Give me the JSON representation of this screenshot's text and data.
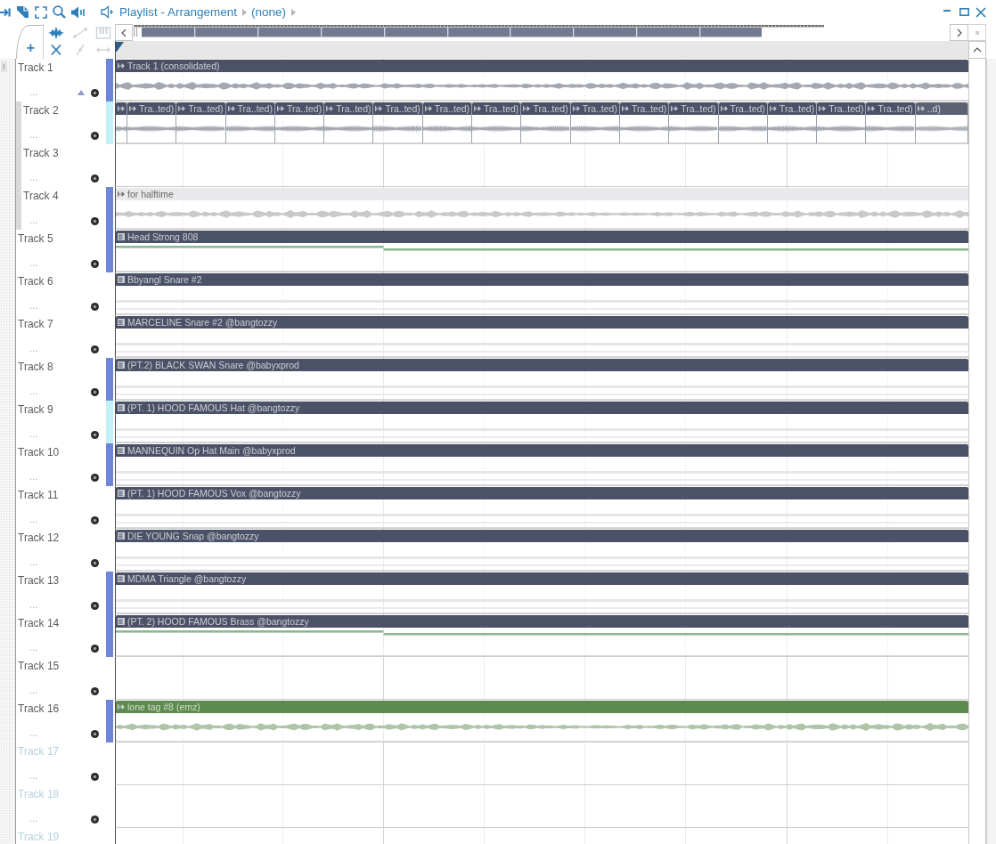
{
  "window": {
    "title": "Playlist - Arrangement",
    "pattern": "(none)"
  },
  "side_panel": {
    "label": "!"
  },
  "toolbar": {
    "add_label": "+",
    "tools": [
      {
        "disabled": false
      },
      {
        "disabled": true
      },
      {
        "disabled": true
      },
      {
        "disabled": false
      },
      {
        "disabled": true
      },
      {
        "disabled": true
      }
    ]
  },
  "tracks": [
    {
      "name": "Track 1",
      "more": "...",
      "color": "#6f86d8",
      "disabled": false,
      "expanded": true,
      "clips": [
        {
          "kind": "audio",
          "label": "Track 1 (consolidated)",
          "color": "#4b5167"
        }
      ],
      "children": [
        {
          "name": "Track 2",
          "more": "...",
          "color": "#c4f1f5",
          "disabled": false,
          "clips": [
            {
              "kind": "audio",
              "color": "#4b5167"
            },
            {
              "kind": "audio",
              "label": "Tra..ted)",
              "color": "#4b5167"
            },
            {
              "kind": "audio",
              "label": "Tra..ted)",
              "color": "#4b5167"
            },
            {
              "kind": "audio",
              "label": "Tra..ted)",
              "color": "#4b5167"
            },
            {
              "kind": "audio",
              "label": "Tra..ted)",
              "color": "#4b5167"
            },
            {
              "kind": "audio",
              "label": "Tra..ted)",
              "color": "#4b5167"
            },
            {
              "kind": "audio",
              "label": "Tra..ted)",
              "color": "#4b5167"
            },
            {
              "kind": "audio",
              "label": "Tra..ted)",
              "color": "#4b5167"
            },
            {
              "kind": "audio",
              "label": "Tra..ted)",
              "color": "#4b5167"
            },
            {
              "kind": "audio",
              "label": "Tra..ted)",
              "color": "#4b5167"
            },
            {
              "kind": "audio",
              "label": "Tra..ted)",
              "color": "#4b5167"
            },
            {
              "kind": "audio",
              "label": "Tra..ted)",
              "color": "#4b5167"
            },
            {
              "kind": "audio",
              "label": "Tra..ted)",
              "color": "#4b5167"
            },
            {
              "kind": "audio",
              "label": "Tra..ted)",
              "color": "#4b5167"
            },
            {
              "kind": "audio",
              "label": "Tra..ted)",
              "color": "#4b5167"
            },
            {
              "kind": "audio",
              "label": "Tra..ted)",
              "color": "#4b5167"
            },
            {
              "kind": "audio",
              "label": "Tra..ted)",
              "color": "#4b5167"
            },
            {
              "kind": "audio",
              "label": "..d)",
              "color": "#5c6273"
            }
          ]
        },
        {
          "name": "Track 3",
          "more": "...",
          "disabled": false
        },
        {
          "name": "Track 4",
          "more": "...",
          "color": "#6f86d8",
          "disabled": false,
          "clips": [
            {
              "kind": "audio",
              "label": "for halftime",
              "color": "#e9e9eb"
            }
          ]
        }
      ]
    },
    {
      "name": "Track 5",
      "more": "...",
      "color": "#6f86d8",
      "disabled": false,
      "clips": [
        {
          "kind": "pattern",
          "label": "Head Strong 808",
          "color": "#4b5167",
          "sustained": true
        }
      ]
    },
    {
      "name": "Track 6",
      "more": "...",
      "disabled": false,
      "clips": [
        {
          "kind": "pattern",
          "label": "Bbyangl Snare #2",
          "color": "#4b5167",
          "sustained": false
        }
      ]
    },
    {
      "name": "Track 7",
      "more": "...",
      "disabled": false,
      "clips": [
        {
          "kind": "pattern",
          "label": "MARCELINE Snare #2 @bangtozzy",
          "color": "#4b5167",
          "sustained": false
        }
      ]
    },
    {
      "name": "Track 8",
      "more": "...",
      "color": "#6f86d8",
      "disabled": false,
      "clips": [
        {
          "kind": "pattern",
          "label": "(PT.2) BLACK SWAN Snare @babyxprod",
          "color": "#4b5167",
          "sustained": false
        }
      ]
    },
    {
      "name": "Track 9",
      "more": "...",
      "color": "#c4f1f5",
      "disabled": false,
      "clips": [
        {
          "kind": "pattern",
          "label": "(PT. 1) HOOD FAMOUS Hat @bangtozzy",
          "color": "#4b5167",
          "sustained": false
        }
      ]
    },
    {
      "name": "Track 10",
      "more": "...",
      "color": "#6f86d8",
      "disabled": false,
      "clips": [
        {
          "kind": "pattern",
          "label": "MANNEQUIN Op Hat Main @babyxprod",
          "color": "#4b5167",
          "sustained": false
        }
      ]
    },
    {
      "name": "Track 11",
      "more": "...",
      "disabled": false,
      "clips": [
        {
          "kind": "pattern",
          "label": "(PT. 1) HOOD FAMOUS Vox @bangtozzy",
          "color": "#4b5167",
          "sustained": false
        }
      ]
    },
    {
      "name": "Track 12",
      "more": "...",
      "disabled": false,
      "clips": [
        {
          "kind": "pattern",
          "label": "DIE YOUNG Snap @bangtozzy",
          "color": "#4b5167",
          "sustained": false
        }
      ]
    },
    {
      "name": "Track 13",
      "more": "...",
      "color": "#6f86d8",
      "disabled": false,
      "clips": [
        {
          "kind": "pattern",
          "label": "MDMA Triangle @bangtozzy",
          "color": "#4b5167",
          "sustained": false
        }
      ]
    },
    {
      "name": "Track 14",
      "more": "...",
      "color": "#6f86d8",
      "disabled": false,
      "clips": [
        {
          "kind": "pattern",
          "label": "(PT. 2) HOOD FAMOUS Brass @bangtozzy",
          "color": "#4b5167",
          "sustained": true
        }
      ]
    },
    {
      "name": "Track 15",
      "more": "...",
      "disabled": false
    },
    {
      "name": "Track 16",
      "more": "...",
      "color": "#6f86d8",
      "disabled": false,
      "clips": [
        {
          "kind": "audio",
          "label": "lone tag #8 (emz)",
          "color": "#5d8a4e"
        }
      ]
    },
    {
      "name": "Track 17",
      "more": "...",
      "disabled": true
    },
    {
      "name": "Track 18",
      "more": "...",
      "disabled": true
    },
    {
      "name": "Track 19",
      "disabled": true
    }
  ]
}
